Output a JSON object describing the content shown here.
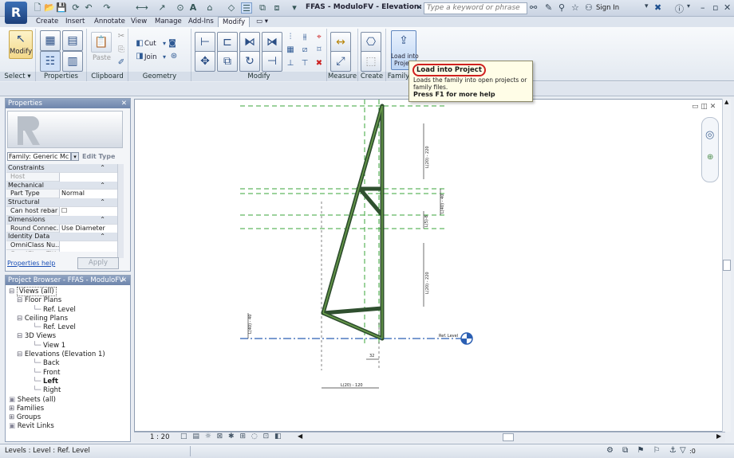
{
  "app": {
    "logo": "R",
    "title": "FFAS - ModuloFV - Elevation: L...",
    "search_placeholder": "Type a keyword or phrase",
    "sign_in": "Sign In"
  },
  "tabs": [
    {
      "label": "Create"
    },
    {
      "label": "Insert"
    },
    {
      "label": "Annotate"
    },
    {
      "label": "View"
    },
    {
      "label": "Manage"
    },
    {
      "label": "Add-Ins"
    },
    {
      "label": "Modify",
      "active": true
    }
  ],
  "ribbon": {
    "modify_label": "Modify",
    "cut_label": "Cut",
    "join_label": "Join",
    "paste_label": "Paste",
    "load_label_1": "Load into",
    "load_label_2": "Project",
    "panels": [
      "Select ▾",
      "Properties",
      "Clipboard",
      "Geometry",
      "Modify",
      "Measure",
      "Create",
      "Family E"
    ]
  },
  "tooltip": {
    "title": "Load into Project",
    "description": "Loads the family into open projects or family files.",
    "help": "Press F1 for more help"
  },
  "properties": {
    "title": "Properties",
    "family_type": "Family: Generic Mc",
    "edit_type": "Edit Type",
    "rows": [
      {
        "label": "Constraints",
        "group": true
      },
      {
        "label": "Host",
        "value": "",
        "dim": true
      },
      {
        "label": "Mechanical",
        "group": true
      },
      {
        "label": "Part Type",
        "value": "Normal"
      },
      {
        "label": "Structural",
        "group": true
      },
      {
        "label": "Can host rebar",
        "value": "☐"
      },
      {
        "label": "Dimensions",
        "group": true
      },
      {
        "label": "Round Connec...",
        "value": "Use Diameter"
      },
      {
        "label": "Identity Data",
        "group": true
      },
      {
        "label": "OmniClass Nu...",
        "value": ""
      },
      {
        "label": "OmniClass Title",
        "value": "",
        "dim": true
      }
    ],
    "help_link": "Properties help",
    "apply": "Apply"
  },
  "browser": {
    "title": "Project Browser - FFAS - ModuloFV",
    "items": [
      {
        "label": "Views (all)",
        "indent": 0,
        "toggle": "⊟"
      },
      {
        "label": "Floor Plans",
        "indent": 1,
        "toggle": "⊟"
      },
      {
        "label": "Ref. Level",
        "indent": 3
      },
      {
        "label": "Ceiling Plans",
        "indent": 1,
        "toggle": "⊟"
      },
      {
        "label": "Ref. Level",
        "indent": 3
      },
      {
        "label": "3D Views",
        "indent": 1,
        "toggle": "⊟"
      },
      {
        "label": "View 1",
        "indent": 3
      },
      {
        "label": "Elevations (Elevation 1)",
        "indent": 1,
        "toggle": "⊟"
      },
      {
        "label": "Back",
        "indent": 3
      },
      {
        "label": "Front",
        "indent": 3
      },
      {
        "label": "Left",
        "indent": 3,
        "bold": true
      },
      {
        "label": "Right",
        "indent": 3
      },
      {
        "label": "Sheets (all)",
        "indent": 0
      },
      {
        "label": "Families",
        "indent": 0,
        "toggle": "⊞"
      },
      {
        "label": "Groups",
        "indent": 0,
        "toggle": "⊞"
      },
      {
        "label": "Revit Links",
        "indent": 0
      }
    ]
  },
  "drawing": {
    "dims": [
      "L(20) - 220",
      "L(40) - 40",
      "L(5)-8",
      "L(20) - 220",
      "L(40) - 40",
      "32",
      "L(20) - 120"
    ],
    "level_label": "Ref. Level"
  },
  "viewbar": {
    "scale": "1 : 20"
  },
  "status": {
    "text": "Levels : Level : Ref. Level",
    "filter_count": ":0"
  }
}
